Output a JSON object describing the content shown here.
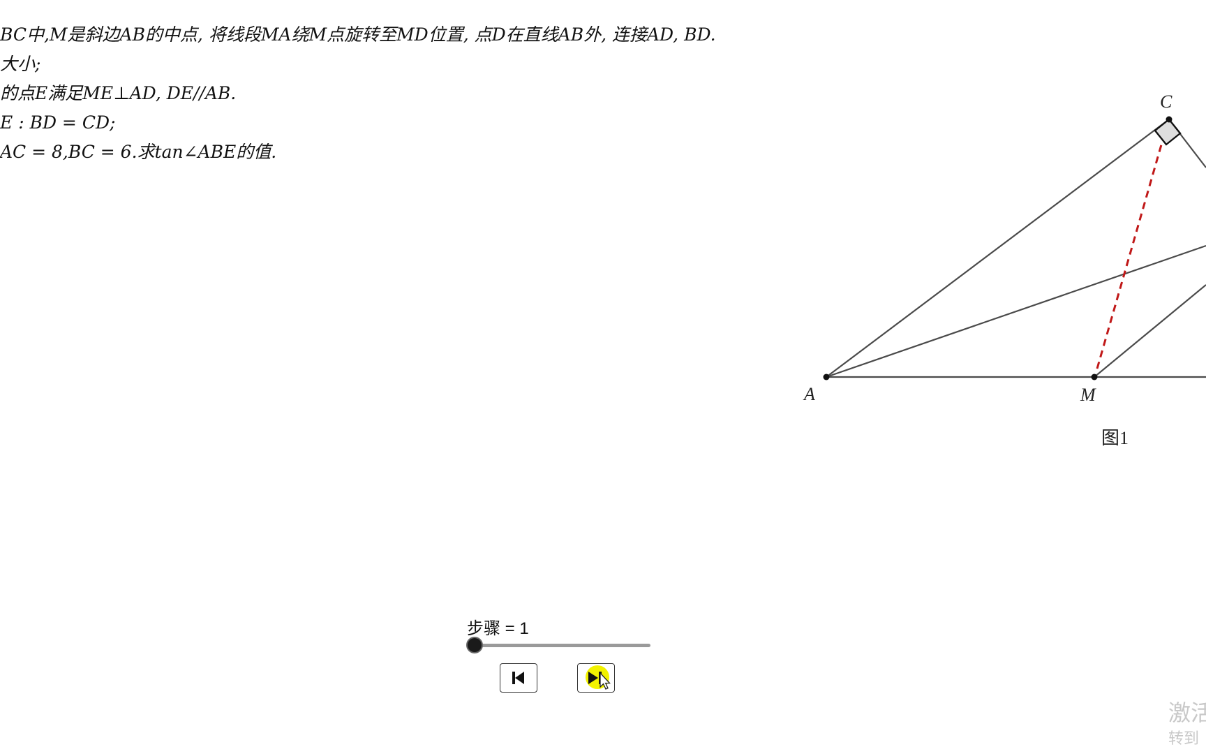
{
  "problem": {
    "lines": [
      "BC中,M是斜边AB的中点, 将线段MA绕M点旋转至MD位置, 点D在直线AB外, 连接AD, BD.",
      "大小;",
      "的点E满足ME⊥AD, DE//AB.",
      "E : BD = CD;",
      "AC = 8,BC = 6.求tan∠ABE的值."
    ]
  },
  "figure": {
    "points": {
      "A": "A",
      "M": "M",
      "C": "C"
    },
    "caption": "图1"
  },
  "controls": {
    "slider_label": "步骤 = 1",
    "slider_value": 1,
    "slider_fraction": 0.0,
    "reset_button": "reset-to-start",
    "next_button": "next-step"
  },
  "watermark": {
    "line1": "激活",
    "line2": "转到"
  },
  "colors": {
    "line": "#4a4a4a",
    "dashed": "#c01818",
    "right_angle_fill": "#dedede",
    "highlight": "#f2f200"
  }
}
